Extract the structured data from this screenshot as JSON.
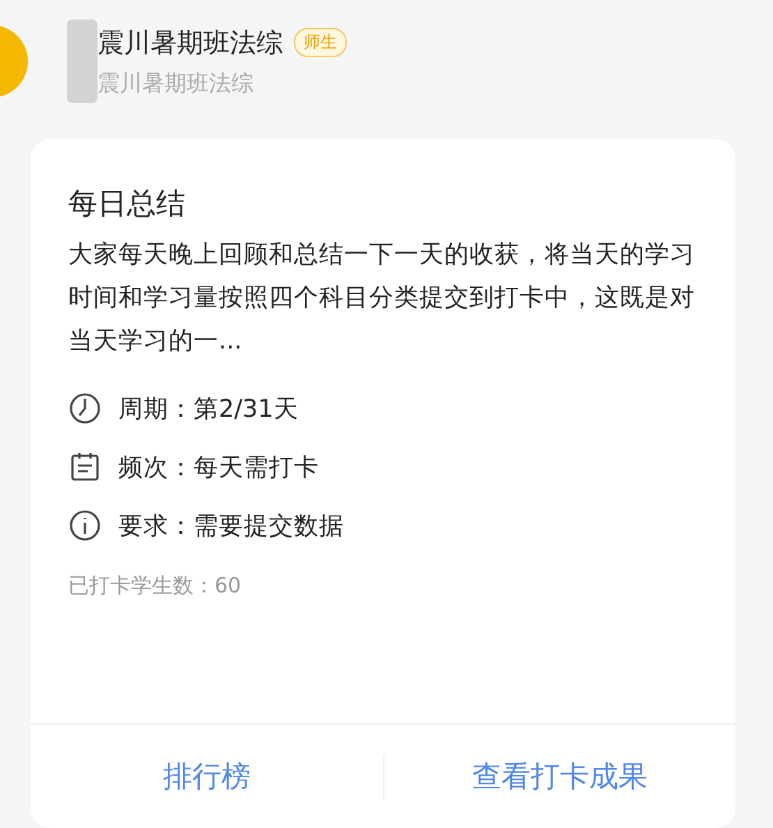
{
  "header": {
    "title": "震川暑期班法综",
    "badge": "师生",
    "subtitle": "震川暑期班法综"
  },
  "card": {
    "title": "每日总结",
    "description": "大家每天晚上回顾和总结一下一天的收获，将当天的学习时间和学习量按照四个科目分类提交到打卡中，这既是对当天学习的一...",
    "details": [
      {
        "kind": "clock",
        "text": "周期：第2/31天"
      },
      {
        "kind": "calendar",
        "text": "频次：每天需打卡"
      },
      {
        "kind": "info",
        "text": "要求：需要提交数据"
      }
    ],
    "count": "已打卡学生数：60",
    "actions": [
      "排行榜",
      "查看打卡成果"
    ]
  }
}
